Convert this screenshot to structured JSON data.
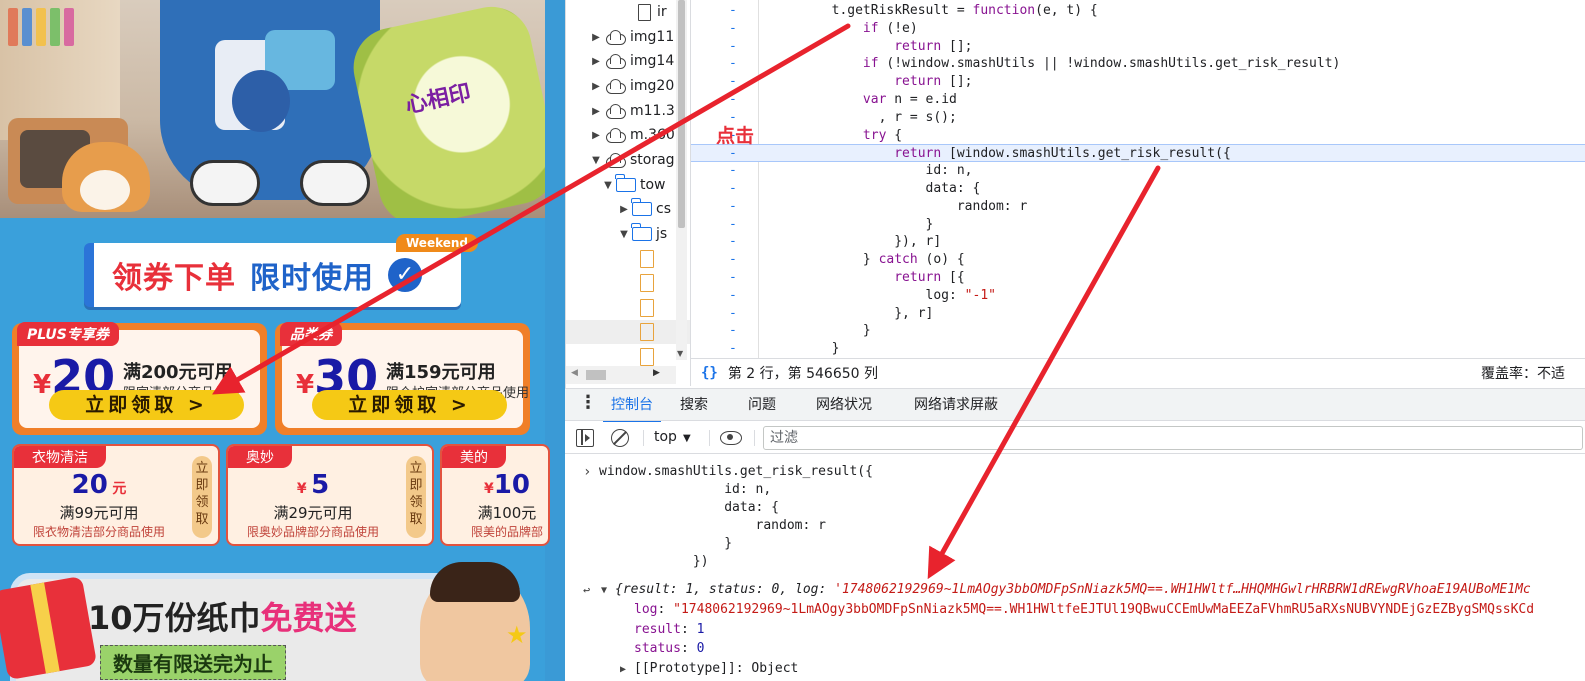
{
  "promo": {
    "hero_brand": "心相印",
    "banner_title_part1": "领券下单",
    "banner_title_part2": "限时使用",
    "banner_check": "✓",
    "weekend_tag": "Weekend",
    "big_coupons": [
      {
        "tag": "PLUS专享券",
        "currency": "¥",
        "amount": "20",
        "condition": "满200元可用",
        "scope": "限家清部分商品使用",
        "button": "立即领取 >"
      },
      {
        "tag": "品类券",
        "currency": "¥",
        "amount": "30",
        "condition": "满159元可用",
        "scope": "限个护家清部分商品使用",
        "button": "立即领取 >"
      }
    ],
    "small_coupons": [
      {
        "tag": "衣物清洁",
        "amount": "20",
        "unit": "元",
        "condition": "满99元可用",
        "scope": "限衣物清洁部分商品使用",
        "side": "立即领取"
      },
      {
        "tag": "奥妙",
        "amount": "5",
        "unit": "¥",
        "condition": "满29元可用",
        "scope": "限奥妙品牌部分商品使用",
        "side": "立即领取"
      },
      {
        "tag": "美的",
        "amount": "10",
        "unit": "¥",
        "condition": "满100元",
        "scope": "限美的品牌部",
        "side": ""
      }
    ],
    "gift_title_main": "10万份纸巾",
    "gift_title_accent": "免费送",
    "gift_subtitle": "数量有限送完为止"
  },
  "tree": {
    "items": [
      {
        "label": "ir",
        "icon": "doc-icon",
        "twisty": ""
      },
      {
        "label": "img11",
        "icon": "cloud-icon",
        "twisty": "▶"
      },
      {
        "label": "img14",
        "icon": "cloud-icon",
        "twisty": "▶"
      },
      {
        "label": "img20",
        "icon": "cloud-icon",
        "twisty": "▶"
      },
      {
        "label": "m11.3",
        "icon": "cloud-icon",
        "twisty": "▶"
      },
      {
        "label": "m.360",
        "icon": "cloud-icon",
        "twisty": "▶"
      },
      {
        "label": "storag",
        "icon": "cloud-icon",
        "twisty": "▼"
      },
      {
        "label": "tow",
        "icon": "folder-icon",
        "twisty": "▼"
      },
      {
        "label": "cs",
        "icon": "folder-icon",
        "twisty": "▶"
      },
      {
        "label": "js",
        "icon": "folder-icon",
        "twisty": "▼"
      },
      {
        "label": "",
        "icon": "file-icon",
        "twisty": ""
      },
      {
        "label": "",
        "icon": "file-icon",
        "twisty": ""
      },
      {
        "label": "",
        "icon": "file-icon",
        "twisty": ""
      },
      {
        "label": "",
        "icon": "file-icon",
        "twisty": ""
      },
      {
        "label": "",
        "icon": "file-icon",
        "twisty": ""
      }
    ]
  },
  "editor": {
    "gutter_marker": "-",
    "lines": [
      "        t.getRiskResult = function(e, t) {",
      "            if (!e)",
      "                return [];",
      "            if (!window.smashUtils || !window.smashUtils.get_risk_result)",
      "                return [];",
      "            var n = e.id",
      "              , r = s();",
      "            try {",
      "                return [window.smashUtils.get_risk_result({",
      "                    id: n,",
      "                    data: {",
      "                        random: r",
      "                    }",
      "                }), r]",
      "            } catch (o) {",
      "                return [{",
      "                    log: \"-1\"",
      "                }, r]",
      "            }",
      "        }"
    ],
    "highlighted_line": 8
  },
  "status": {
    "braces": "{}",
    "position": "第 2 行，第 546650 列",
    "coverage": "覆盖率：不适"
  },
  "drawer_tabs": [
    "控制台",
    "搜索",
    "问题",
    "网络状况",
    "网络请求屏蔽"
  ],
  "console_bar": {
    "context": "top",
    "filter_placeholder": "过滤"
  },
  "console": {
    "input": "window.smashUtils.get_risk_result({\n                id: n,\n                data: {\n                    random: r\n                }\n            })",
    "summary_prefix": "{result: 1, status: 0, log: ",
    "summary_log": "'1748062192969~1LmAOgy3bbOMDFpSnNiazk5MQ==.WH1HWltf…HHQMHGwlrHRBRW1dREwgRVhoaE19AUBoME1Mc",
    "log_key": "log",
    "log_value": "\"1748062192969~1LmAOgy3bbOMDFpSnNiazk5MQ==.WH1HWltfeEJTUl19QBwuCCEmUwMaEEZaFVhmRU5aRXsNUBVYNDEjGzEZBygSMQssKCd",
    "result_key": "result",
    "result_value": "1",
    "status_key": "status",
    "status_value": "0",
    "proto_label": "[[Prototype]]: Object"
  },
  "annotation": {
    "click_label": "点击",
    "arrow_color": "#e8232d"
  }
}
